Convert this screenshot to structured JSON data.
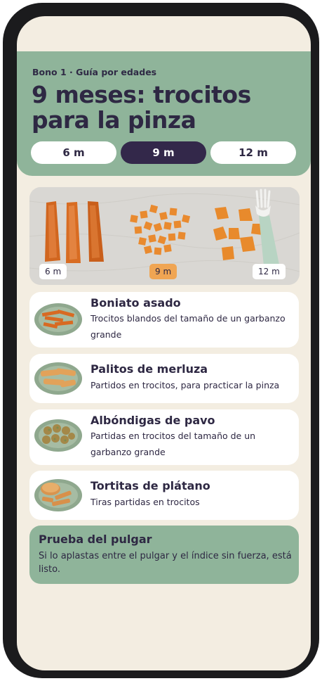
{
  "header": {
    "eyebrow": "Bono 1 · Guía por edades",
    "title": "9 meses: trocitos para la pinza"
  },
  "tabs": [
    {
      "label": "6 m",
      "active": false
    },
    {
      "label": "9 m",
      "active": true
    },
    {
      "label": "12 m",
      "active": false
    }
  ],
  "photo": {
    "tags": [
      "6 m",
      "9 m",
      "12 m"
    ],
    "highlight_color": "#f0a553"
  },
  "foods": [
    {
      "name": "Boniato asado",
      "desc": "Trocitos blandos del tamaño de un garbanzo grande",
      "icon": "sweet-potato-plate-icon"
    },
    {
      "name": "Palitos de merluza",
      "desc": "Partidos en trocitos, para practicar la pinza",
      "icon": "fish-sticks-plate-icon"
    },
    {
      "name": "Albóndigas de pavo",
      "desc": "Partidas en trocitos del tamaño de un garbanzo grande",
      "icon": "meatballs-plate-icon"
    },
    {
      "name": "Tortitas de plátano",
      "desc": "Tiras partidas en trocitos",
      "icon": "banana-pancakes-plate-icon"
    }
  ],
  "tip": {
    "title": "Prueba del pulgar",
    "text": "Si lo aplastas entre el pulgar y el índice sin fuerza, está listo."
  },
  "colors": {
    "accent_green": "#8fb49a",
    "dark_purple": "#33284a",
    "background": "#f3ede1"
  }
}
